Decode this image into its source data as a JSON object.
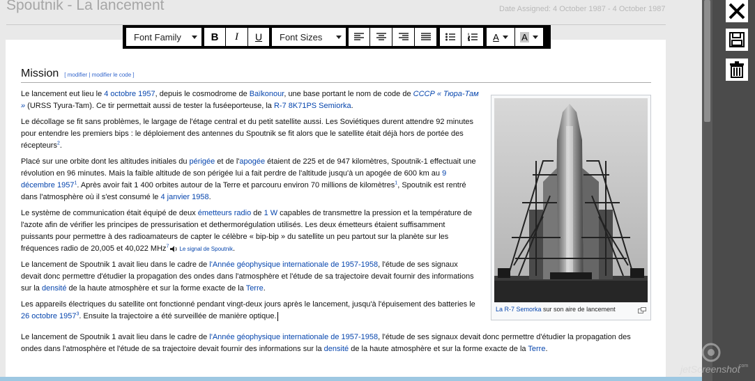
{
  "page": {
    "title": "Spoutnik - La lancement",
    "date_assigned": "Date Assigned: 4 October 1987 - 4 October 1987"
  },
  "toolbar": {
    "font_family": "Font Family",
    "bold": "B",
    "italic": "I",
    "underline": "U",
    "font_sizes": "Font Sizes",
    "font_color_glyph": "A",
    "highlight_glyph": "A"
  },
  "section": {
    "heading": "Mission",
    "edit_links": "[ modifier | modifier le code ]"
  },
  "paragraphs": {
    "p1": {
      "a": "Le lancement eut lieu le ",
      "date": "4 octobre 1957",
      "b": ", depuis le cosmodrome de ",
      "place": "Baïkonour",
      "c": ", une base portant le nom de code de ",
      "code": "СССР « Тюра-Там »",
      "d": " (URSS Tyura-Tam). Ce tir permettait aussi de tester la fuséeporteuse, la ",
      "rocket": "R-7 8K71PS Semiorka",
      "e": "."
    },
    "p2": {
      "a": "Le décollage se fit sans problèmes, le largage de l'étage central et du petit satellite aussi. Les Soviétiques durent attendre 92 minutes pour entendre les premiers bips : le déploiement des antennes du Spoutnik se fit alors que le satellite était déjà hors de portée des récepteurs",
      "sup": "2",
      "b": "."
    },
    "p3": {
      "a": "Placé sur une orbite dont les altitudes initiales du ",
      "perigee": "périgée",
      "b": " et de l'",
      "apogee": "apogée",
      "c": " étaient de 225 et de 947 kilomètres, Spoutnik-1 effectuait une révolution en 96 minutes. Mais la faible altitude de son périgée lui a fait perdre de l'altitude jusqu'à un apogée de 600 km au ",
      "date": "9 décembre 1957",
      "sup1": "1",
      "d": ". Après avoir fait 1 400 orbites autour de la Terre et parcouru environ 70 millions de kilomètres",
      "sup2": "1",
      "e": ", Spoutnik est rentré dans l'atmosphère où il s'est consumé le ",
      "date2": "4 janvier 1958",
      "f": "."
    },
    "p4": {
      "a": "Le système de communication était équipé de deux ",
      "emitters": "émetteurs radio",
      "b": " de ",
      "power": "1 W",
      "c": " capables de transmettre la pression et la température de l'azote afin de vérifier les principes de pressurisation et dethermorégulation utilisés. Les deux émetteurs étaient suffisamment puissants pour permettre à des radioamateurs de capter le célèbre « bip-bip » du satellite un peu partout sur la planète sur les fréquences radio de 20,005 et 40,022 MHz",
      "sup": "7",
      "sound": "Le signal de Spoutnik",
      "d": "."
    },
    "p5": {
      "a": "Le lancement de Spoutnik 1 avait lieu dans le cadre de ",
      "igy": "l'Année géophysique internationale de 1957-1958",
      "b": ", l'étude de ses signaux devait donc permettre d'étudier la propagation des ondes dans l'atmosphère et l'étude de sa trajectoire devait fournir des informations sur la ",
      "density": "densité",
      "c": " de la haute atmosphère et sur la forme exacte de la ",
      "earth": "Terre",
      "d": "."
    },
    "p6": {
      "a": "Les appareils électriques du satellite ont fonctionné pendant vingt-deux jours après le lancement, jusqu'à l'épuisement des batteries le ",
      "date": "26 octobre 1957",
      "sup": "3",
      "b": ". Ensuite la trajectoire a été surveillée de manière optique."
    },
    "p7": {
      "a": "Le lancement de Spoutnik 1 avait lieu dans le cadre de ",
      "igy": "l'Année géophysique internationale de 1957-1958",
      "b": ", l'étude de ses signaux devait donc permettre d'étudier la propagation des ondes dans l'atmosphère et l'étude de sa trajectoire devait fournir des informations sur la ",
      "density": "densité",
      "c": " de la haute atmosphère et sur la forme exacte de la ",
      "earth": "Terre",
      "d": "."
    }
  },
  "figure": {
    "caption_link": "La R-7 Semorka",
    "caption_rest": " sur son aire de lancement"
  },
  "side_buttons": {
    "icons": [
      "close-icon",
      "save-icon",
      "trash-icon"
    ]
  },
  "watermark": {
    "text": "jetScreenshot",
    "suffix": ".com"
  },
  "colors": {
    "link": "#0645ad",
    "toolbar_bg": "#000000",
    "overlay_bg": "#e9e9e9",
    "panel_bg": "#4b4b4b"
  }
}
